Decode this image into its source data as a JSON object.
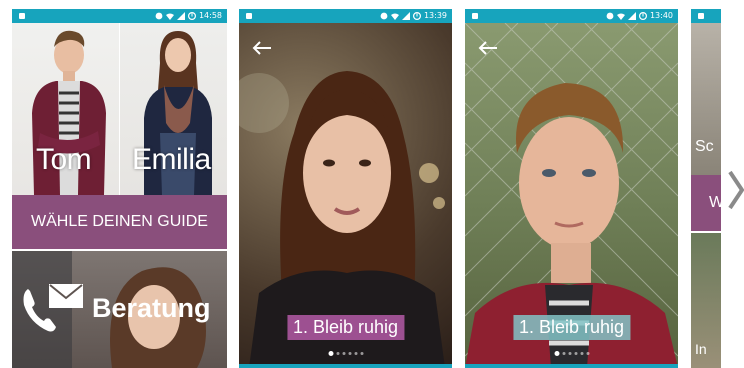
{
  "colors": {
    "status_bar": "#17a4bd",
    "guide_band": "#8a4f7c",
    "step_emilia": "#b45ba6",
    "step_tom": "#83c3c6"
  },
  "screen1": {
    "time": "14:58",
    "guides": [
      {
        "name": "Tom"
      },
      {
        "name": "Emilia"
      }
    ],
    "choose_guide": "WÄHLE DEINEN GUIDE",
    "beratung": "Beratung",
    "icons": [
      "phone-icon",
      "envelope-icon"
    ]
  },
  "screen2": {
    "time": "13:39",
    "step": "1. Bleib ruhig",
    "dots_total": 6,
    "dot_active": 1
  },
  "screen3": {
    "time": "13:40",
    "step": "1. Bleib ruhig",
    "dots_total": 6,
    "dot_active": 1
  },
  "screen4": {
    "partial_labels": [
      "Sc",
      "W",
      "In"
    ]
  },
  "carousel": {
    "next_icon": "chevron-right-icon"
  }
}
